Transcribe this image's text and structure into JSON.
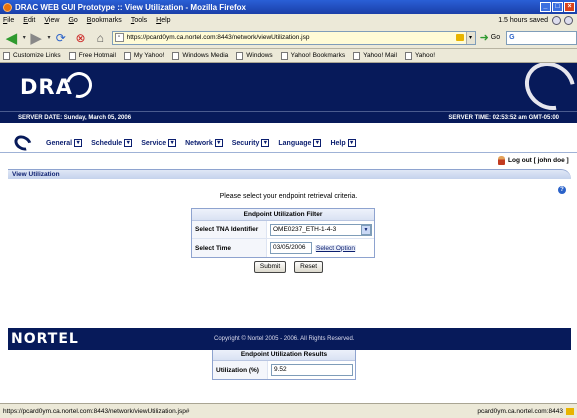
{
  "window": {
    "title": "DRAC WEB GUI Prototype :: View Utilization - Mozilla Firefox"
  },
  "menubar": {
    "items": [
      "File",
      "Edit",
      "View",
      "Go",
      "Bookmarks",
      "Tools",
      "Help"
    ],
    "saved_status": "1.5 hours saved"
  },
  "navbar": {
    "url": "https://pcard0ym.ca.nortel.com:8443/network/viewUtilization.jsp",
    "go_label": "Go",
    "search_placeholder": "G"
  },
  "bookmarks": [
    "Customize Links",
    "Free Hotmail",
    "My Yahoo!",
    "Windows Media",
    "Windows",
    "Yahoo! Bookmarks",
    "Yahoo! Mail",
    "Yahoo!"
  ],
  "banner": {
    "logo": "DRA",
    "server_date": "SERVER DATE: Sunday, March 05, 2006",
    "server_time": "SERVER TIME: 02:53:52 am GMT-05:00"
  },
  "nav": {
    "items": [
      "General",
      "Schedule",
      "Service",
      "Network",
      "Security",
      "Language",
      "Help"
    ],
    "logout": "Log out [ john doe ]"
  },
  "section": {
    "title": "View Utilization"
  },
  "prompt": "Please select your endpoint retrieval criteria.",
  "filter": {
    "title": "Endpoint Utilization Filter",
    "tna_label": "Select TNA Identifier",
    "tna_value": "OME0237_ETH-1-4-3",
    "time_label": "Select Time",
    "time_value": "03/05/2006",
    "select_option": "Select Option"
  },
  "buttons": {
    "submit": "Submit",
    "reset": "Reset"
  },
  "results": {
    "title": "Endpoint Utilization Results",
    "util_label": "Utilization (%)",
    "util_value": "9.52"
  },
  "footer": {
    "logo": "NORTEL",
    "copyright": "Copyright © Nortel 2005 - 2006. All Rights Reserved."
  },
  "statusbar": {
    "left": "https://pcard0ym.ca.nortel.com:8443/network/viewUtilization.jsp#",
    "right": "pcard0ym.ca.nortel.com:8443"
  }
}
